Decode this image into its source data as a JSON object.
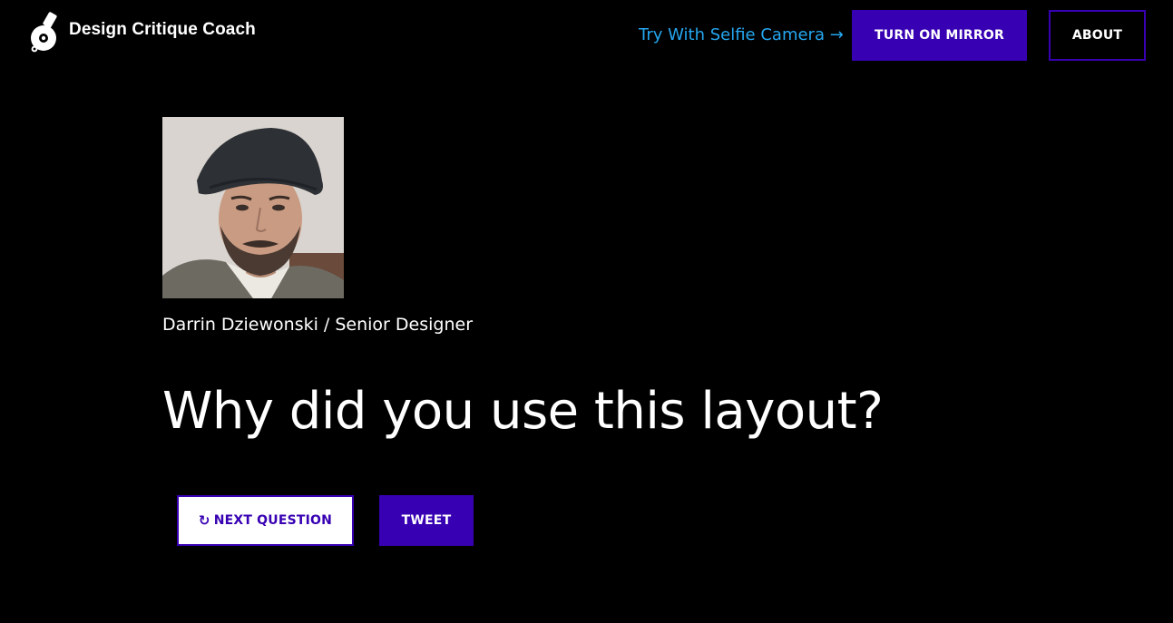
{
  "header": {
    "brand_name": "Design Critique Coach",
    "brand_icon": "whistle-icon",
    "selfie_link": "Try With Selfie Camera →",
    "mirror_button": "TURN ON MIRROR",
    "about_button": "ABOUT"
  },
  "critique": {
    "author": "Darrin Dziewonski / Senior Designer",
    "question": "Why did you use this layout?"
  },
  "actions": {
    "next_icon": "↻",
    "next_label": "NEXT QUESTION",
    "tweet_label": "TWEET"
  },
  "colors": {
    "background": "#000000",
    "accent": "#3700b3",
    "link": "#25a7f0",
    "text": "#ffffff"
  }
}
